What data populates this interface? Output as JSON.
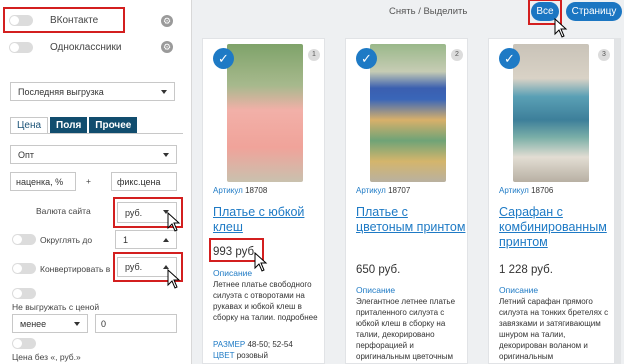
{
  "settings": {
    "networks": [
      {
        "label": "ВКонтакте",
        "enabled": false
      },
      {
        "label": "Одноклассники",
        "enabled": false
      }
    ],
    "export_select": "Последняя выгрузка",
    "tabs": [
      "Цена",
      "Поля",
      "Прочее"
    ],
    "price_mode": "Опт",
    "markup_placeholder": "наценка, %",
    "plus_sign": "+",
    "fixed_placeholder": "фикс.цена",
    "currency_label": "Валюта сайта",
    "currency_value": "руб.",
    "round_label": "Округлять до",
    "round_value": "1",
    "convert_label": "Конвертировать в",
    "convert_value": "руб.",
    "noexport_label": "Не выгружать с ценой",
    "compare_value": "менее",
    "compare_amount": "0",
    "price_suffix_label": "Цена без «, руб.»"
  },
  "preview": {
    "snap_text": "Снять / Выделить",
    "all_button": "Все",
    "page_button": "Страницу",
    "article_prefix": "Артикул",
    "desc_heading": "Описание",
    "cards": [
      {
        "num": "1",
        "article": "18708",
        "title": "Платье с юбкой клеш",
        "price": "993 руб.",
        "desc": "Летнее платье свободного силуэта с отворотами на рукавах и юбкой клеш в сборку на талии. подробнее",
        "size_label": "РАЗМЕР",
        "size_value": "48-50; 52-54",
        "color_label": "ЦВЕТ",
        "color_value": "розовый"
      },
      {
        "num": "2",
        "article": "18707",
        "title": "Платье с цветоным принтом",
        "price": "650 руб.",
        "desc": "Элегантное летнее платье приталенного силуэта с юбкой клеш в сборку на талии, декорировано перфорацией и оригинальным цветочным"
      },
      {
        "num": "3",
        "article": "18706",
        "title": "Сарафан с комбинированным принтом",
        "price": "1 228 руб.",
        "desc": "Летний сарафан прямого силуэта на тонких бретелях с завязками и затягивающим шнуром на талии, декорирован воланом и оригинальным"
      }
    ]
  },
  "colors": {
    "accent": "#1e7ac5",
    "tab_dark": "#114d6e",
    "highlight": "#d31f1f"
  }
}
